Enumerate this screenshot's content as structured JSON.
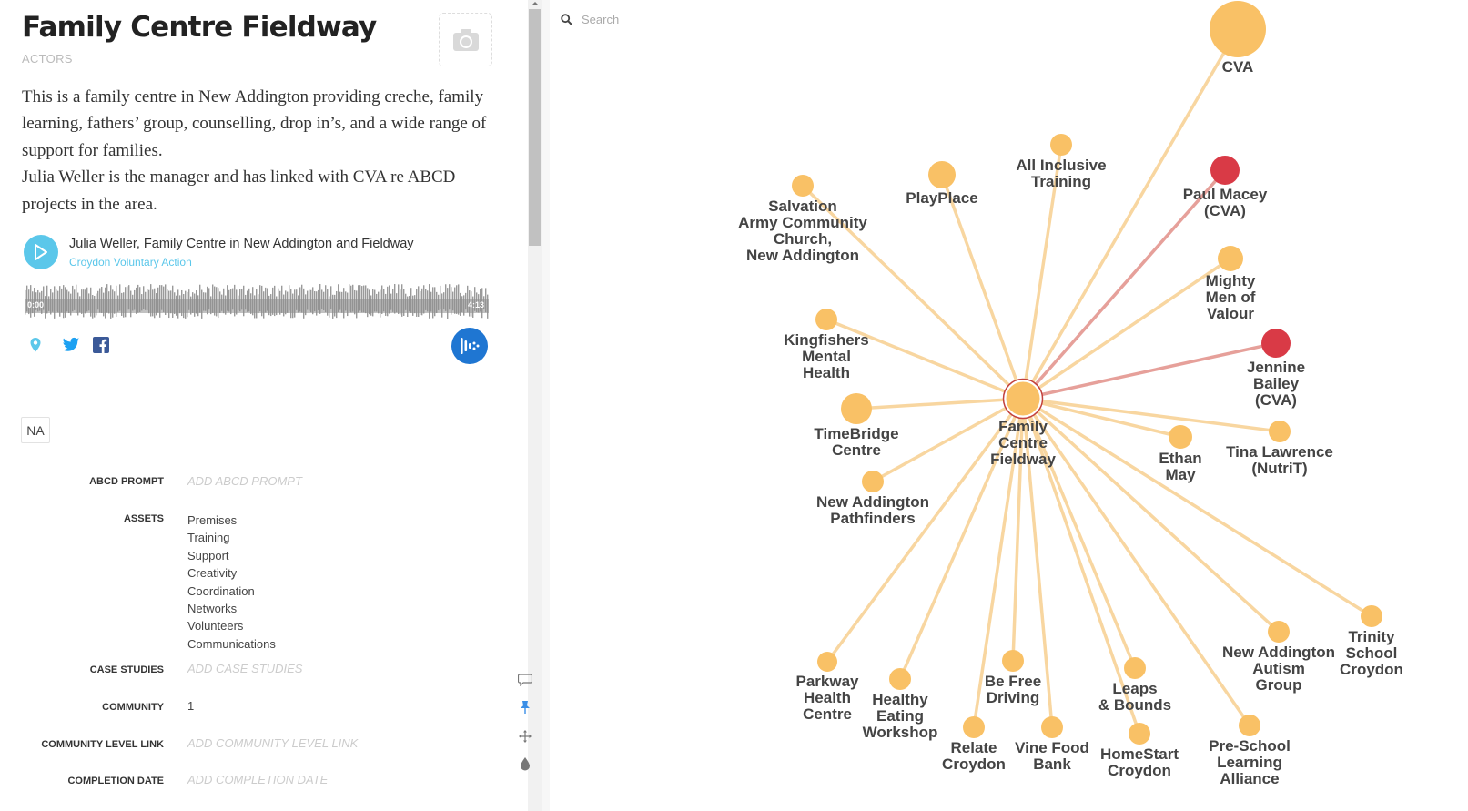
{
  "panel": {
    "title": "Family Centre Fieldway",
    "subtitle": "ACTORS",
    "description": [
      "This is a family centre in New Addington providing creche, family learning, fathers’ group, counselling, drop in’s, and a wide range of support for families.",
      "Julia Weller is the manager and has linked with CVA re ABCD projects in the area."
    ],
    "audio": {
      "title": "Julia Weller, Family Centre in New Addington and Fieldway",
      "author": "Croydon Voluntary Action",
      "time_start": "0:00",
      "time_end": "4:13"
    },
    "badge": "NA",
    "fields": {
      "abcd_prompt_label": "ABCD PROMPT",
      "abcd_prompt_placeholder": "ADD ABCD PROMPT",
      "assets_label": "ASSETS",
      "assets": [
        "Premises",
        "Training",
        "Support",
        "Creativity",
        "Coordination",
        "Networks",
        "Volunteers",
        "Communications"
      ],
      "case_studies_label": "CASE STUDIES",
      "case_studies_placeholder": "ADD CASE STUDIES",
      "community_label": "COMMUNITY",
      "community_value": "1",
      "community_link_label": "COMMUNITY LEVEL LINK",
      "community_link_placeholder": "ADD COMMUNITY LEVEL LINK",
      "completion_date_label": "COMPLETION DATE",
      "completion_date_placeholder": "ADD COMPLETION DATE"
    }
  },
  "search": {
    "placeholder": "Search"
  },
  "colors": {
    "node_default": "#f9c166",
    "node_highlight": "#d93a46",
    "edge_default": "#f8d6a0",
    "edge_highlight": "#e6a09a",
    "accent": "#5bc7ea",
    "audioboom": "#1f76d2"
  },
  "network": {
    "center": {
      "label": [
        "Family",
        "Centre",
        "Fieldway"
      ]
    },
    "nodes": [
      {
        "id": "cva",
        "label": [
          "CVA"
        ],
        "kind": "default"
      },
      {
        "id": "all-inclusive-training",
        "label": [
          "All Inclusive",
          "Training"
        ],
        "kind": "default"
      },
      {
        "id": "playplace",
        "label": [
          "PlayPlace"
        ],
        "kind": "default"
      },
      {
        "id": "salvation-army",
        "label": [
          "Salvation",
          "Army Community",
          "Church,",
          "New Addington"
        ],
        "kind": "default"
      },
      {
        "id": "paul-macey",
        "label": [
          "Paul Macey",
          "(CVA)"
        ],
        "kind": "highlight"
      },
      {
        "id": "mighty-men",
        "label": [
          "Mighty",
          "Men of",
          "Valour"
        ],
        "kind": "default"
      },
      {
        "id": "kingfishers",
        "label": [
          "Kingfishers",
          "Mental",
          "Health"
        ],
        "kind": "default"
      },
      {
        "id": "jennine-bailey",
        "label": [
          "Jennine",
          "Bailey",
          "(CVA)"
        ],
        "kind": "highlight"
      },
      {
        "id": "timebridge",
        "label": [
          "TimeBridge",
          "Centre"
        ],
        "kind": "default"
      },
      {
        "id": "ethan-may",
        "label": [
          "Ethan",
          "May"
        ],
        "kind": "default"
      },
      {
        "id": "tina-lawrence",
        "label": [
          "Tina Lawrence",
          "(NutriT)"
        ],
        "kind": "default"
      },
      {
        "id": "new-addington-pathfinders",
        "label": [
          "New Addington",
          "Pathfinders"
        ],
        "kind": "default"
      },
      {
        "id": "trinity-school",
        "label": [
          "Trinity",
          "School",
          "Croydon"
        ],
        "kind": "default"
      },
      {
        "id": "new-addington-autism",
        "label": [
          "New Addington",
          "Autism",
          "Group"
        ],
        "kind": "default"
      },
      {
        "id": "parkway-health",
        "label": [
          "Parkway",
          "Health",
          "Centre"
        ],
        "kind": "default"
      },
      {
        "id": "healthy-eating",
        "label": [
          "Healthy",
          "Eating",
          "Workshop"
        ],
        "kind": "default"
      },
      {
        "id": "be-free-driving",
        "label": [
          "Be Free",
          "Driving"
        ],
        "kind": "default"
      },
      {
        "id": "leaps-bounds",
        "label": [
          "Leaps",
          "& Bounds"
        ],
        "kind": "default"
      },
      {
        "id": "relate-croydon",
        "label": [
          "Relate",
          "Croydon"
        ],
        "kind": "default"
      },
      {
        "id": "vine-food-bank",
        "label": [
          "Vine Food",
          "Bank"
        ],
        "kind": "default"
      },
      {
        "id": "homestart-croydon",
        "label": [
          "HomeStart",
          "Croydon"
        ],
        "kind": "default"
      },
      {
        "id": "pre-school-learning",
        "label": [
          "Pre-School",
          "Learning",
          "Alliance"
        ],
        "kind": "default"
      }
    ]
  }
}
